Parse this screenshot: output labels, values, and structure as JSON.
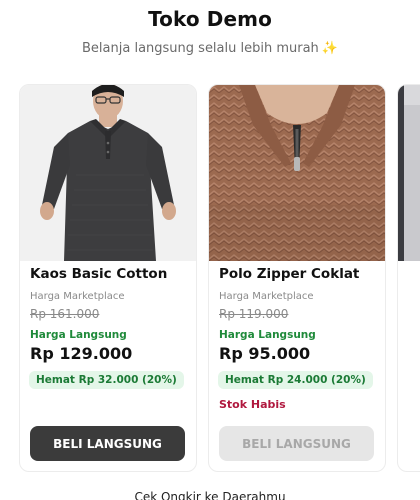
{
  "header": {
    "title": "Toko Demo",
    "subtitle": "Belanja langsung selalu lebih murah",
    "subtitle_icon": "✨"
  },
  "products": [
    {
      "name": "Kaos Basic Cotton",
      "marketplace_label": "Harga Marketplace",
      "marketplace_price": "Rp 161.000",
      "direct_label": "Harga Langsung",
      "direct_price": "Rp 129.000",
      "savings": "Hemat Rp 32.000 (20%)",
      "stock_status": "",
      "button_label": "BELI LANGSUNG",
      "button_enabled": true,
      "image_icon": "model-gray-polo-photo"
    },
    {
      "name": "Polo Zipper Coklat",
      "marketplace_label": "Harga Marketplace",
      "marketplace_price": "Rp 119.000",
      "direct_label": "Harga Langsung",
      "direct_price": "Rp 95.000",
      "savings": "Hemat Rp 24.000 (20%)",
      "stock_status": "Stok Habis",
      "button_label": "BELI LANGSUNG",
      "button_enabled": false,
      "image_icon": "brown-zipper-polo-photo"
    }
  ],
  "footer": {
    "shipping_link": "Cek Ongkir ke Daerahmu"
  },
  "colors": {
    "accent_green": "#1f8a3a",
    "savings_bg": "#e4f6e9",
    "out_of_stock": "#b0183e",
    "button_dark": "#3b3b3b",
    "button_disabled": "#e6e6e6"
  }
}
